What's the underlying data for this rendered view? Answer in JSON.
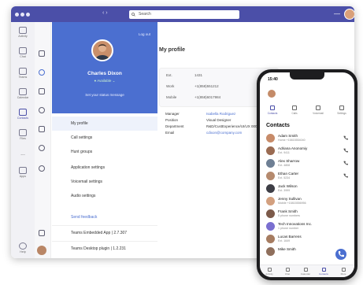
{
  "window": {
    "search_placeholder": "Search",
    "nav_arrows": "‹ ›",
    "minimize": "—"
  },
  "rail": {
    "items": [
      {
        "label": "Activity"
      },
      {
        "label": "Chat"
      },
      {
        "label": "Teams"
      },
      {
        "label": "Calendar"
      },
      {
        "label": "Contacts"
      },
      {
        "label": "Files"
      },
      {
        "label": "..."
      },
      {
        "label": "Apps"
      },
      {
        "label": "Help"
      }
    ]
  },
  "profile": {
    "logout": "Log out",
    "name": "Charles Dixon",
    "status": "● Available ⌄",
    "status_message": "Set your status message"
  },
  "menu": {
    "items": [
      "My profile",
      "Call settings",
      "Hunt groups",
      "Application settings",
      "Voicemail settings",
      "Audio settings"
    ],
    "feedback": "Send feedback",
    "versions": [
      "Teams Embedded App | 2.7.307",
      "Teams Desktop plugin | 1.2.231"
    ]
  },
  "my_profile": {
    "title": "My profile",
    "phones": [
      {
        "label": "Ext.",
        "value": "1431"
      },
      {
        "label": "Work",
        "value": "+1(858)551212"
      },
      {
        "label": "Mobile",
        "value": "+1(858)6017984"
      }
    ],
    "info": [
      {
        "label": "Manager",
        "value": "Isabella Rodriguez"
      },
      {
        "label": "Position",
        "value": "Visual Designer"
      },
      {
        "label": "Department",
        "value": "R&D/CustExperience/UI/UX 00021"
      },
      {
        "label": "Email",
        "value": "cdixon@company.com"
      }
    ]
  },
  "phone": {
    "time": "15:40",
    "tabs": [
      "Contacts",
      "Calls",
      "Voicemail",
      "Settings"
    ],
    "title": "Contacts",
    "contacts": [
      {
        "name": "Adam Smith",
        "sub": "Home +15815554040",
        "color": "#c78b69"
      },
      {
        "name": "Adriana Anonomiy",
        "sub": "Ext. 9411",
        "color": "#9a6b52"
      },
      {
        "name": "Alex Sharrow",
        "sub": "Ext. 4808",
        "color": "#6e7f94"
      },
      {
        "name": "Ethan Carter",
        "sub": "Ext. 5234",
        "color": "#b58a6e"
      },
      {
        "name": "Jack Wilson",
        "sub": "Ext. 3999",
        "color": "#3e3e46"
      },
      {
        "name": "Jenny Sullivan",
        "sub": "Mobile +15815556956",
        "color": "#d3a07f"
      },
      {
        "name": "Frank Smith",
        "sub": "5 phone numbers",
        "color": "#7c5a4a"
      },
      {
        "name": "Tech Innovations Inc.",
        "sub": "1 phone number",
        "color": "#7a6fd0"
      },
      {
        "name": "Lucas Barrens",
        "sub": "Ext. 1649",
        "color": "#a67c61"
      },
      {
        "name": "Mike Smith",
        "sub": "",
        "color": "#8f6f5c"
      }
    ],
    "nav": [
      "Activity",
      "Chat",
      "Calendar",
      "Contacts",
      "More"
    ]
  },
  "colors": {
    "brand": "#4b4fa8",
    "profile_panel": "#4b6fd0",
    "available": "#5cc46f"
  }
}
